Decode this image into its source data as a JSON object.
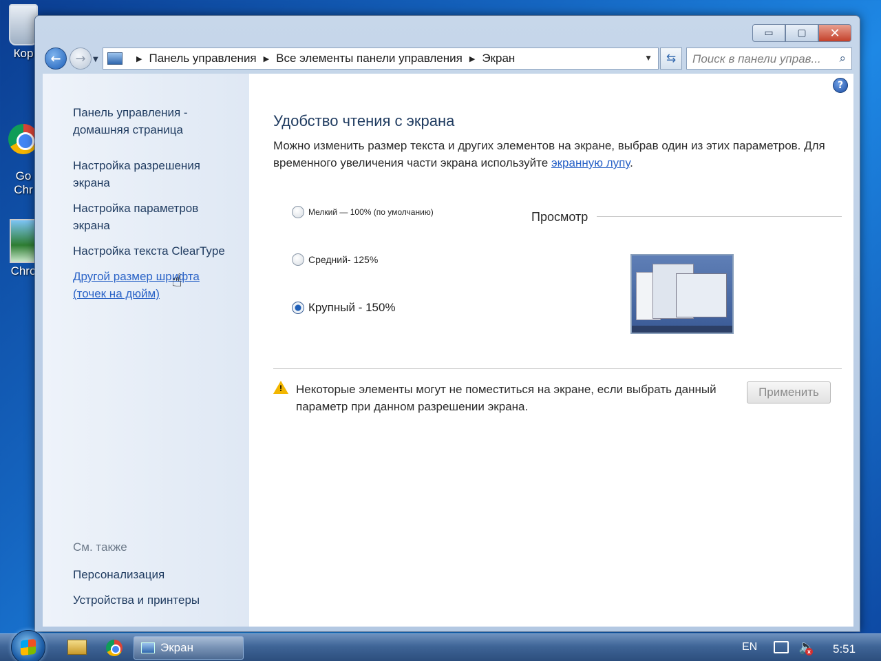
{
  "desktop": {
    "icons": [
      {
        "label": "Кор"
      },
      {
        "label": "Go\nChr"
      },
      {
        "label": "Chro"
      }
    ]
  },
  "window": {
    "controls": {
      "minimize": "▭",
      "maximize": "▢",
      "close": "✕"
    },
    "address": {
      "crumbs": [
        "Панель управления",
        "Все элементы панели управления",
        "Экран"
      ]
    },
    "search": {
      "placeholder": "Поиск в панели управ..."
    }
  },
  "sidebar": {
    "items": [
      {
        "label": "Панель управления -\nдомашняя страница"
      },
      {
        "label": "Настройка разрешения\nэкрана"
      },
      {
        "label": "Настройка параметров\nэкрана"
      },
      {
        "label": "Настройка текста ClearType"
      },
      {
        "label": "Другой размер шрифта\n(точек на дюйм)"
      }
    ],
    "see_also": "См. также",
    "see_also_items": [
      {
        "label": "Персонализация"
      },
      {
        "label": "Устройства и принтеры"
      }
    ]
  },
  "main": {
    "heading": "Удобство чтения с экрана",
    "desc_part1": "Можно изменить размер текста и других элементов на экране, выбрав один из этих параметров. Для временного увеличения части экрана используйте ",
    "desc_link": "экранную лупу",
    "desc_part2": ".",
    "options": [
      {
        "label": "Мелкий — 100% (по умолчанию)",
        "checked": false
      },
      {
        "label": "Средний- 125%",
        "checked": false
      },
      {
        "label": "Крупный - 150%",
        "checked": true
      }
    ],
    "preview_label": "Просмотр",
    "warning": "Некоторые элементы могут не поместиться на экране, если выбрать данный параметр при данном разрешении экрана.",
    "apply": "Применить"
  },
  "taskbar": {
    "task_label": "Экран",
    "lang": "EN",
    "clock": "5:51"
  }
}
